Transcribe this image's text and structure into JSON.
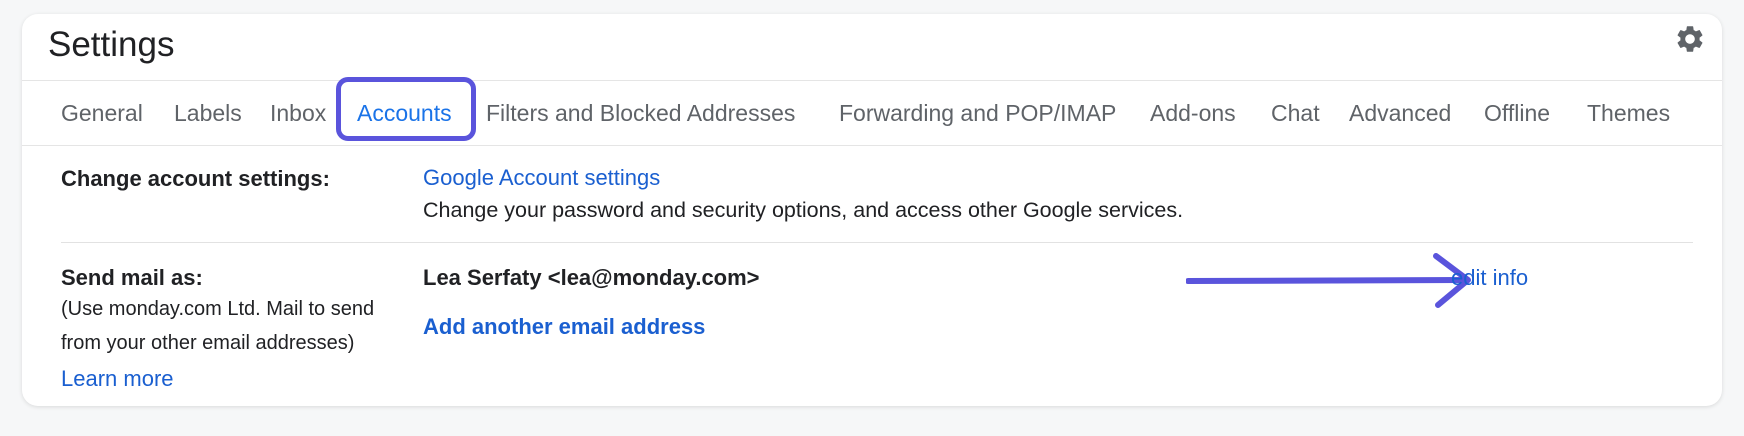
{
  "header": {
    "title": "Settings",
    "settings_icon": "gear-icon"
  },
  "tabs": [
    {
      "label": "General",
      "active": false
    },
    {
      "label": "Labels",
      "active": false
    },
    {
      "label": "Inbox",
      "active": false
    },
    {
      "label": "Accounts",
      "active": true
    },
    {
      "label": "Filters and Blocked Addresses",
      "active": false
    },
    {
      "label": "Forwarding and POP/IMAP",
      "active": false
    },
    {
      "label": "Add-ons",
      "active": false
    },
    {
      "label": "Chat",
      "active": false
    },
    {
      "label": "Advanced",
      "active": false
    },
    {
      "label": "Offline",
      "active": false
    },
    {
      "label": "Themes",
      "active": false
    }
  ],
  "change_account": {
    "label": "Change account settings:",
    "link": "Google Account settings",
    "description": "Change your password and security options, and access other Google services."
  },
  "send_mail": {
    "label": "Send mail as:",
    "note_line1": "(Use monday.com Ltd. Mail to send",
    "note_line2": "from your other email addresses)",
    "learn_more": "Learn more",
    "sender": "Lea Serfaty <lea@monday.com>",
    "add_address": "Add another email address",
    "edit_info": "edit info"
  },
  "colors": {
    "link": "#1a5fd0",
    "active_tab": "#1a73e8",
    "annotation": "#5a54dc",
    "text": "#202124",
    "muted": "#5f6368"
  }
}
